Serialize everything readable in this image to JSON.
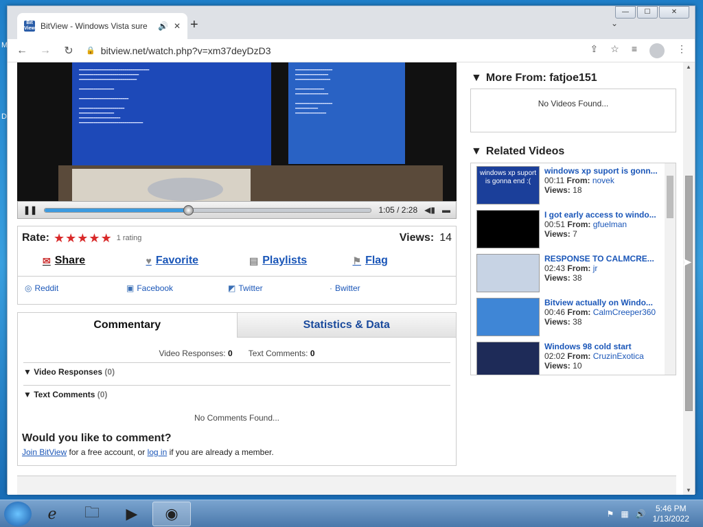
{
  "browser": {
    "tab_title": "BitView - Windows Vista sure",
    "favicon_text": "Bit View",
    "url": "bitview.net/watch.php?v=xm37deyDzD3",
    "win_min": "—",
    "win_max": "☐",
    "win_close": "✕"
  },
  "player": {
    "time": "1:05 / 2:28",
    "progress_fraction": 0.44
  },
  "rating": {
    "label": "Rate:",
    "stars": "★★★★★",
    "count": "1 rating",
    "views_label": "Views:",
    "views_value": "14"
  },
  "actions": {
    "share": "Share",
    "favorite": "Favorite",
    "playlists": "Playlists",
    "flag": "Flag"
  },
  "share_links": {
    "reddit": "Reddit",
    "facebook": "Facebook",
    "twitter": "Twitter",
    "bwitter": "Bwitter"
  },
  "commentary": {
    "tab_commentary": "Commentary",
    "tab_stats": "Statistics & Data",
    "video_responses_label": "Video Responses:",
    "video_responses_count": "0",
    "text_comments_label": "Text Comments:",
    "text_comments_count": "0",
    "section_video_responses": "Video Responses",
    "section_video_responses_n": "(0)",
    "section_text_comments": "Text Comments",
    "section_text_comments_n": "(0)",
    "no_comments": "No Comments Found...",
    "prompt": "Would you like to comment?",
    "join_link": "Join BitView",
    "join_mid": " for a free account, or ",
    "login_link": "log in",
    "join_end": " if you are already a member."
  },
  "sidebar": {
    "more_from": "More From: fatjoe151",
    "no_videos": "No Videos Found...",
    "related_title": "Related Videos",
    "from_label": "From:",
    "views_label": "Views:",
    "related": [
      {
        "title": "windows xp suport is gonn...",
        "duration": "00:11",
        "user": "novek",
        "views": "18",
        "thumb_caption": "windows xp suport is gonna end :(",
        "thumb_color": "#1b3f9a"
      },
      {
        "title": "I got early access to windo...",
        "duration": "00:51",
        "user": "gfuelman",
        "views": "7",
        "thumb_caption": "",
        "thumb_color": "#000000"
      },
      {
        "title": "RESPONSE TO CALMCRE...",
        "duration": "02:43",
        "user": "jr",
        "views": "38",
        "thumb_caption": "",
        "thumb_color": "#c7d3e4"
      },
      {
        "title": "Bitview actually on Windo...",
        "duration": "00:46",
        "user": "CalmCreeper360",
        "views": "38",
        "thumb_caption": "",
        "thumb_color": "#3f86d6"
      },
      {
        "title": "Windows 98 cold start",
        "duration": "02:02",
        "user": "CruzinExotica",
        "views": "10",
        "thumb_caption": "",
        "thumb_color": "#1e2b58"
      }
    ]
  },
  "taskbar": {
    "time": "5:46 PM",
    "date": "1/13/2022"
  }
}
